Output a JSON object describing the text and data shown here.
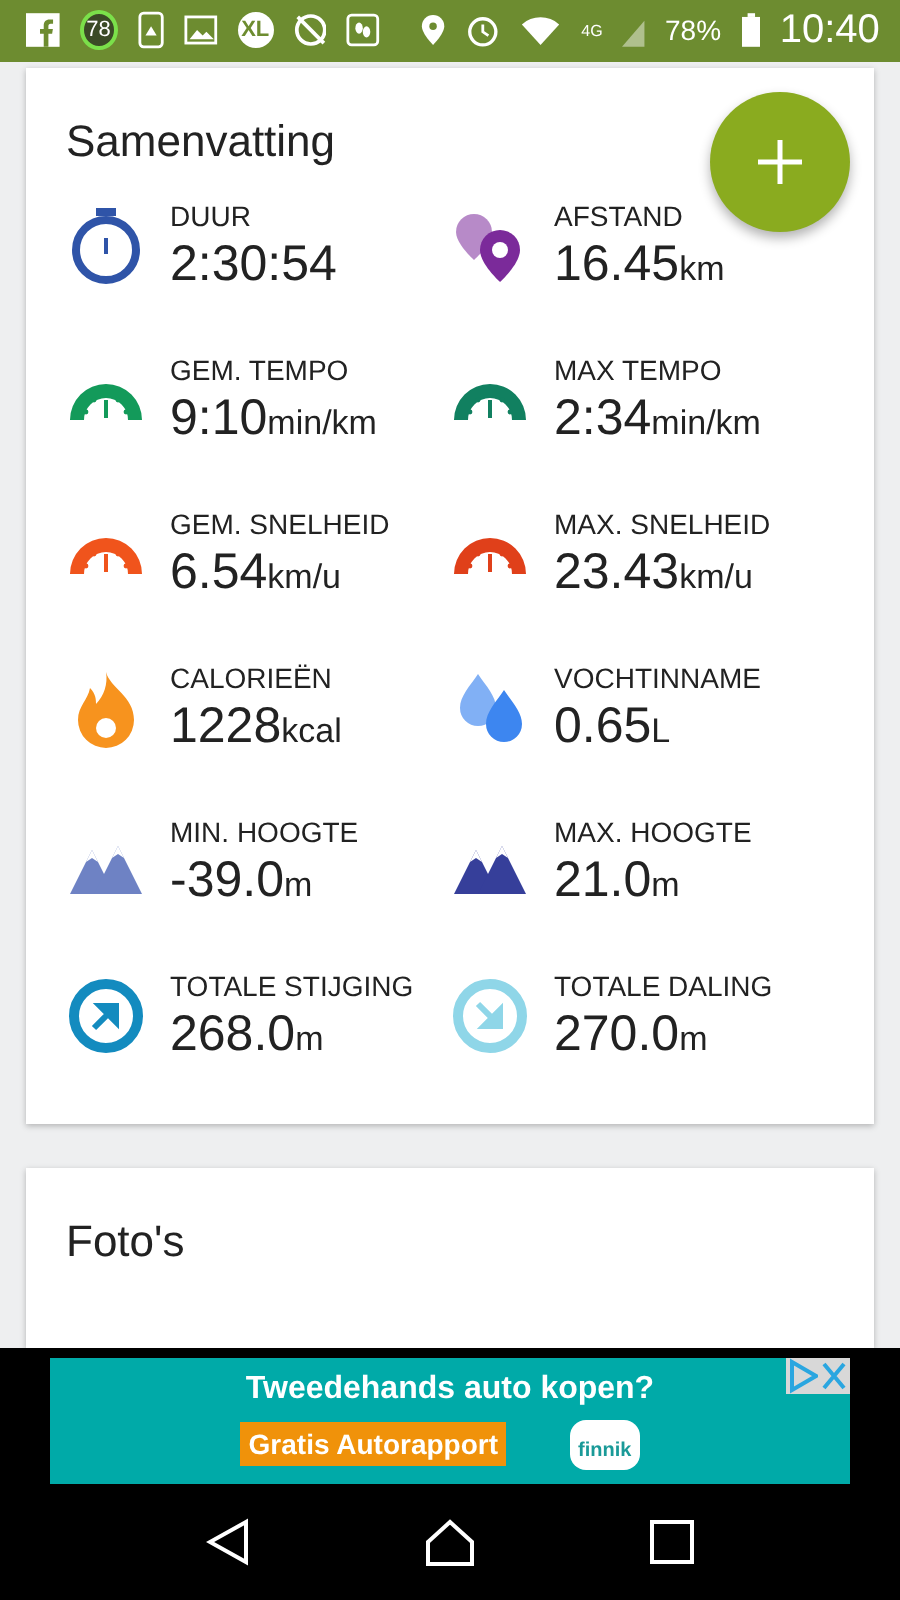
{
  "status_bar": {
    "badge": "78",
    "xl": "XL",
    "network": "4G",
    "battery": "78%",
    "time": "10:40"
  },
  "summary": {
    "title": "Samenvatting",
    "stats": [
      {
        "kind": "stopwatch",
        "color": "#2f54a8",
        "label": "DUUR",
        "value": "2:30:54"
      },
      {
        "kind": "pins",
        "color": "#7b2a9a",
        "label": "AFSTAND",
        "value": "16.45",
        "unit": "km"
      },
      {
        "kind": "gauge",
        "color": "#139a5a",
        "label": "GEM. TEMPO",
        "value": "9:10",
        "unit": "min/km"
      },
      {
        "kind": "gauge",
        "color": "#118060",
        "label": "MAX TEMPO",
        "value": "2:34",
        "unit": "min/km"
      },
      {
        "kind": "gauge",
        "color": "#f0541c",
        "label": "GEM. SNELHEID",
        "value": "6.54",
        "unit": "km/u"
      },
      {
        "kind": "gauge",
        "color": "#e0401a",
        "label": "MAX. SNELHEID",
        "value": "23.43",
        "unit": "km/u"
      },
      {
        "kind": "flame",
        "color": "#f7931e",
        "label": "CALORIEËN",
        "value": "1228",
        "unit": "kcal"
      },
      {
        "kind": "drops",
        "color": "#3d86f0",
        "label": "VOCHTINNAME",
        "value": "0.65",
        "unit": "L"
      },
      {
        "kind": "mountains",
        "color": "#6e82c4",
        "label": "MIN. HOOGTE",
        "value": "-39.0",
        "unit": "m"
      },
      {
        "kind": "mountains",
        "color": "#363f9a",
        "label": "MAX. HOOGTE",
        "value": "21.0",
        "unit": "m"
      },
      {
        "kind": "up",
        "color": "#138bbf",
        "label": "TOTALE STIJGING",
        "value": "268.0",
        "unit": "m"
      },
      {
        "kind": "down",
        "color": "#8fd6e8",
        "label": "TOTALE DALING",
        "value": "270.0",
        "unit": "m"
      }
    ]
  },
  "photos": {
    "title": "Foto's"
  },
  "ad": {
    "headline": "Tweedehands auto kopen?",
    "cta": "Gratis Autorapport",
    "logo": "finnik"
  }
}
